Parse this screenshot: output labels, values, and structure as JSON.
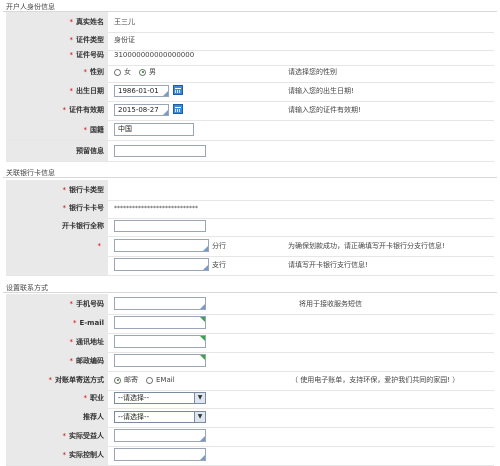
{
  "sections": {
    "account_holder": "开户人身份信息",
    "bank_card": "关联银行卡信息",
    "contact": "设置联系方式"
  },
  "identity": {
    "name_label": "真实姓名",
    "name_value": "王三儿",
    "id_type_label": "证件类型",
    "id_type_value": "身份证",
    "id_no_label": "证件号码",
    "id_no_value": "310000000000000000",
    "gender_label": "性别",
    "gender_female": "女",
    "gender_male": "男",
    "gender_hint": "请选择您的性别",
    "birth_label": "出生日期",
    "birth_value": "1986-01-01",
    "birth_hint": "请输入您的出生日期!",
    "expiry_label": "证件有效期",
    "expiry_value": "2015-08-27",
    "expiry_hint": "请输入您的证件有效期!",
    "nationality_label": "国籍",
    "nationality_value": "中国",
    "reserved_label": "预留信息",
    "reserved_value": ""
  },
  "bank": {
    "card_type_label": "银行卡类型",
    "card_no_label": "银行卡卡号",
    "card_no_value": "****************************",
    "bank_name_label": "开卡银行全称",
    "branch_suffix": "分行",
    "branch_hint": "为确保划款成功，请正确填写开卡银行分支行信息!",
    "subbranch_suffix": "支行",
    "subbranch_hint": "请填写开卡银行支行信息!"
  },
  "contact": {
    "mobile_label": "手机号码",
    "mobile_hint": "将用于接收服务短信",
    "email_label": "E-mail",
    "address_label": "通讯地址",
    "zip_label": "邮政编码",
    "statement_label": "对账单寄送方式",
    "statement_post": "邮寄",
    "statement_email": "EMail",
    "statement_hint": "（ 使用电子账单，支持环保，爱护我们共同的家园! ）",
    "job_label": "职业",
    "job_value": "--请选择--",
    "referrer_label": "推荐人",
    "referrer_value": "--请选择--",
    "beneficiary_label": "实际受益人",
    "controller_label": "实际控制人"
  }
}
